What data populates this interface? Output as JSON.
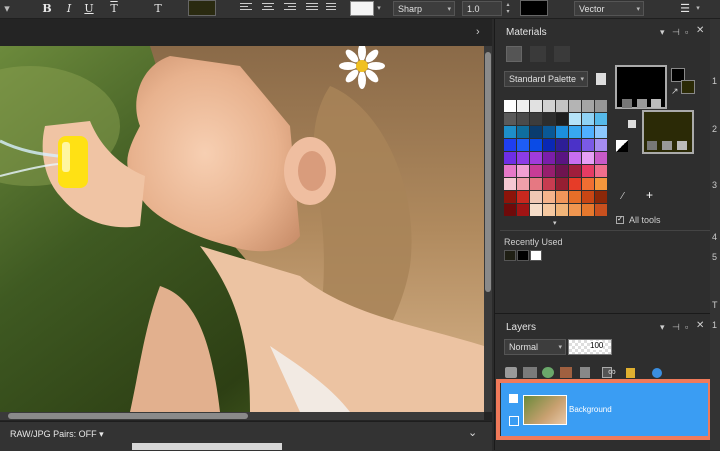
{
  "toolbar": {
    "bold_label": "B",
    "italic_label": "I",
    "underline_label": "U",
    "text_icon_label": "T",
    "text_path_icon_label": "T",
    "antialias_value": "Sharp",
    "size_value": "1.0",
    "mode_value": "Vector",
    "menu_label": "☰",
    "fill_color": "#2a2a10",
    "stroke_color": "#000000"
  },
  "materials": {
    "title": "Materials",
    "palette_select": "Standard Palette",
    "all_tools_label": "All tools",
    "recently_used_label": "Recently Used",
    "recent_colors": [
      "#1f1f14",
      "#000000",
      "#ffffff"
    ],
    "foreground_color": "#000000",
    "background_color": "#2b2a06",
    "colors": [
      [
        "#ffffff",
        "#f0f0f0",
        "#e1e1e1",
        "#d2d2d2",
        "#c3c3c3",
        "#b4b4b4",
        "#a5a5a5",
        "#969696"
      ],
      [
        "#5a5a5a",
        "#4b4b4b",
        "#3c3c3c",
        "#2d2d2d",
        "#1e1e1e",
        "#b5e3f8",
        "#8fd2f5",
        "#55b9ea"
      ],
      [
        "#1e8fc9",
        "#0f6e9e",
        "#0a3c6e",
        "#0a5896",
        "#1c8fde",
        "#38a8f0",
        "#50b0ff",
        "#8cc8ff"
      ],
      [
        "#1f3ff0",
        "#1e5df5",
        "#0a4be6",
        "#0a28b4",
        "#2d1e96",
        "#4b32c8",
        "#7a5ae6",
        "#a58cf0"
      ],
      [
        "#6e2ee6",
        "#8c3ce6",
        "#a03cdc",
        "#7a1eaa",
        "#5a1482",
        "#c86ef0",
        "#e6a0f5",
        "#c85ac8"
      ],
      [
        "#e678c8",
        "#f0a0d2",
        "#c83c96",
        "#961e6e",
        "#6e1450",
        "#a01e3c",
        "#e63c64",
        "#f06e8c"
      ],
      [
        "#f5c8d2",
        "#f0a0aa",
        "#e67882",
        "#c83c50",
        "#961e32",
        "#e63c28",
        "#f06e32",
        "#f5963c"
      ],
      [
        "#8c140a",
        "#c8281e",
        "#f0c8b4",
        "#f5b48c",
        "#f0965a",
        "#e66e28",
        "#c84614",
        "#8c2808"
      ],
      [
        "#6e0a0a",
        "#a01414",
        "#f5dcc8",
        "#f5c8a0",
        "#f0b478",
        "#f09650",
        "#e6782d",
        "#c8501e"
      ]
    ]
  },
  "layers": {
    "title": "Layers",
    "blend_mode": "Normal",
    "opacity": "100",
    "layer_name": "Background"
  },
  "status": {
    "raw_label": "RAW/JPG Pairs: OFF ▾"
  },
  "far_right_numbers": [
    "1",
    "2",
    "3",
    "4",
    "5",
    "T",
    "1"
  ]
}
